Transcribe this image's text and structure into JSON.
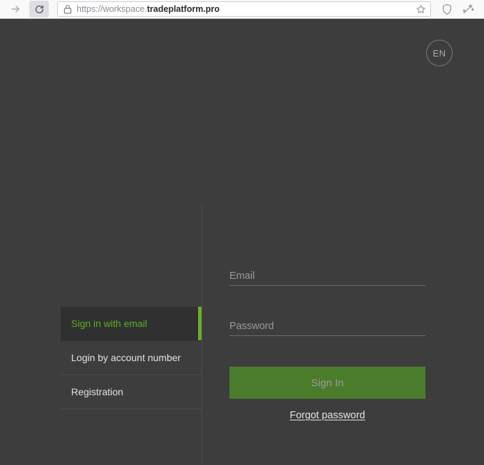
{
  "browser": {
    "forward_icon": "forward-arrow-icon",
    "reload_icon": "reload-icon",
    "lock_icon": "lock-icon",
    "url_prefix": "https://workspace.",
    "url_host": "tradeplatform.pro",
    "url_full": "https://workspace.tradeplatform.pro",
    "star_icon": "star-bookmark-icon",
    "shield_icon": "shield-icon",
    "sparkle_icon": "sparkle-wand-icon"
  },
  "page": {
    "language_button": "EN",
    "accent_green": "#6ab023",
    "active_text_green": "#5bb020",
    "background": "#3d3d3d",
    "active_item_background": "#303030",
    "button_green": "#4a7c2c"
  },
  "menu": {
    "items": [
      {
        "label": "Sign in with email",
        "active": true
      },
      {
        "label": "Login by account number",
        "active": false
      },
      {
        "label": "Registration",
        "active": false
      }
    ]
  },
  "form": {
    "email": {
      "placeholder": "Email",
      "value": ""
    },
    "password": {
      "placeholder": "Password",
      "value": ""
    },
    "submit_label": "Sign In",
    "forgot_label": "Forgot password"
  }
}
